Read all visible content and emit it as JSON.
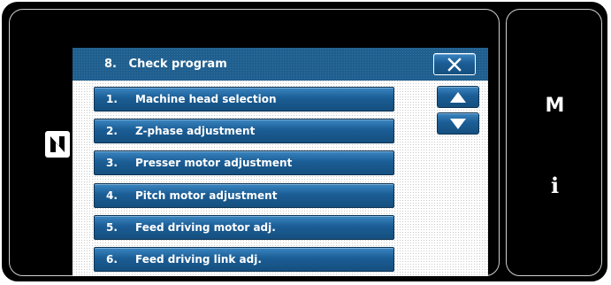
{
  "dialog": {
    "title": "8.   Check program"
  },
  "menu": {
    "items": [
      {
        "number": "1.",
        "label": "Machine head selection"
      },
      {
        "number": "2.",
        "label": "Z-phase adjustment"
      },
      {
        "number": "3.",
        "label": "Presser motor adjustment"
      },
      {
        "number": "4.",
        "label": "Pitch motor adjustment"
      },
      {
        "number": "5.",
        "label": "Feed driving motor adj."
      },
      {
        "number": "6.",
        "label": "Feed driving link adj."
      }
    ]
  },
  "side_panel": {
    "m_key": "M",
    "info_key": "i"
  },
  "icons": {
    "close": "close-icon",
    "scroll_up": "arrow-up-icon",
    "scroll_down": "arrow-down-icon",
    "logo": "juki-logo-icon"
  },
  "colors": {
    "button_blue": "#1b5d95",
    "titlebar_blue": "#1f5f8f",
    "background": "#000000"
  }
}
